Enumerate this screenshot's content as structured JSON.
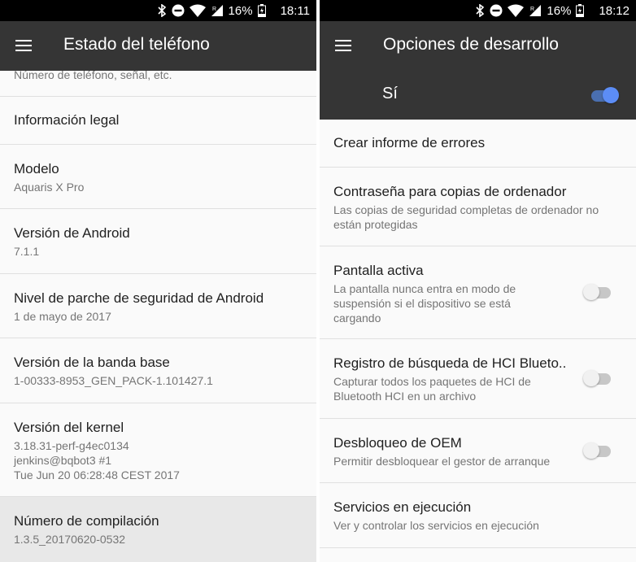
{
  "left": {
    "status": {
      "battery": "16%",
      "time": "18:11"
    },
    "title": "Estado del teléfono",
    "cut_item_subtitle": "Número de teléfono, señal, etc.",
    "items": [
      {
        "title": "Información legal",
        "subtitle": ""
      },
      {
        "title": "Modelo",
        "subtitle": "Aquaris X Pro"
      },
      {
        "title": "Versión de Android",
        "subtitle": "7.1.1"
      },
      {
        "title": "Nivel de parche de seguridad de Android",
        "subtitle": "1 de mayo de 2017"
      },
      {
        "title": "Versión de la banda base",
        "subtitle": "1-00333-8953_GEN_PACK-1.101427.1"
      },
      {
        "title": "Versión del kernel",
        "subtitle": "3.18.31-perf-g4ec0134\njenkins@bqbot3 #1\nTue Jun 20 06:28:48 CEST 2017"
      },
      {
        "title": "Número de compilación",
        "subtitle": "1.3.5_20170620-0532"
      }
    ]
  },
  "right": {
    "status": {
      "battery": "16%",
      "time": "18:12"
    },
    "title": "Opciones de desarrollo",
    "master_switch": {
      "label": "Sí",
      "on": true
    },
    "items": [
      {
        "title": "Crear informe de errores",
        "subtitle": ""
      },
      {
        "title": "Contraseña para copias de ordenador",
        "subtitle": "Las copias de seguridad completas de ordenador no\nestán protegidas"
      },
      {
        "title": "Pantalla activa",
        "subtitle": "La pantalla nunca entra en modo de\nsuspensión si el dispositivo se está\ncargando",
        "toggle": false
      },
      {
        "title": "Registro de búsqueda de HCI Blueto..",
        "subtitle": "Capturar todos los paquetes de HCI de\nBluetooth HCI en un archivo",
        "toggle": false
      },
      {
        "title": "Desbloqueo de OEM",
        "subtitle": "Permitir desbloquear el gestor de arranque",
        "toggle": false
      },
      {
        "title": "Servicios en ejecución",
        "subtitle": "Ver y controlar los servicios en ejecución"
      }
    ]
  },
  "colors": {
    "appbar": "#353535",
    "accent": "#5c8df6",
    "switch_on_track": "#4a6fb0",
    "switch_off_track": "#c7c7c7",
    "switch_off_thumb": "#f1f1f1",
    "highlight_row": "#e8e8e8"
  }
}
